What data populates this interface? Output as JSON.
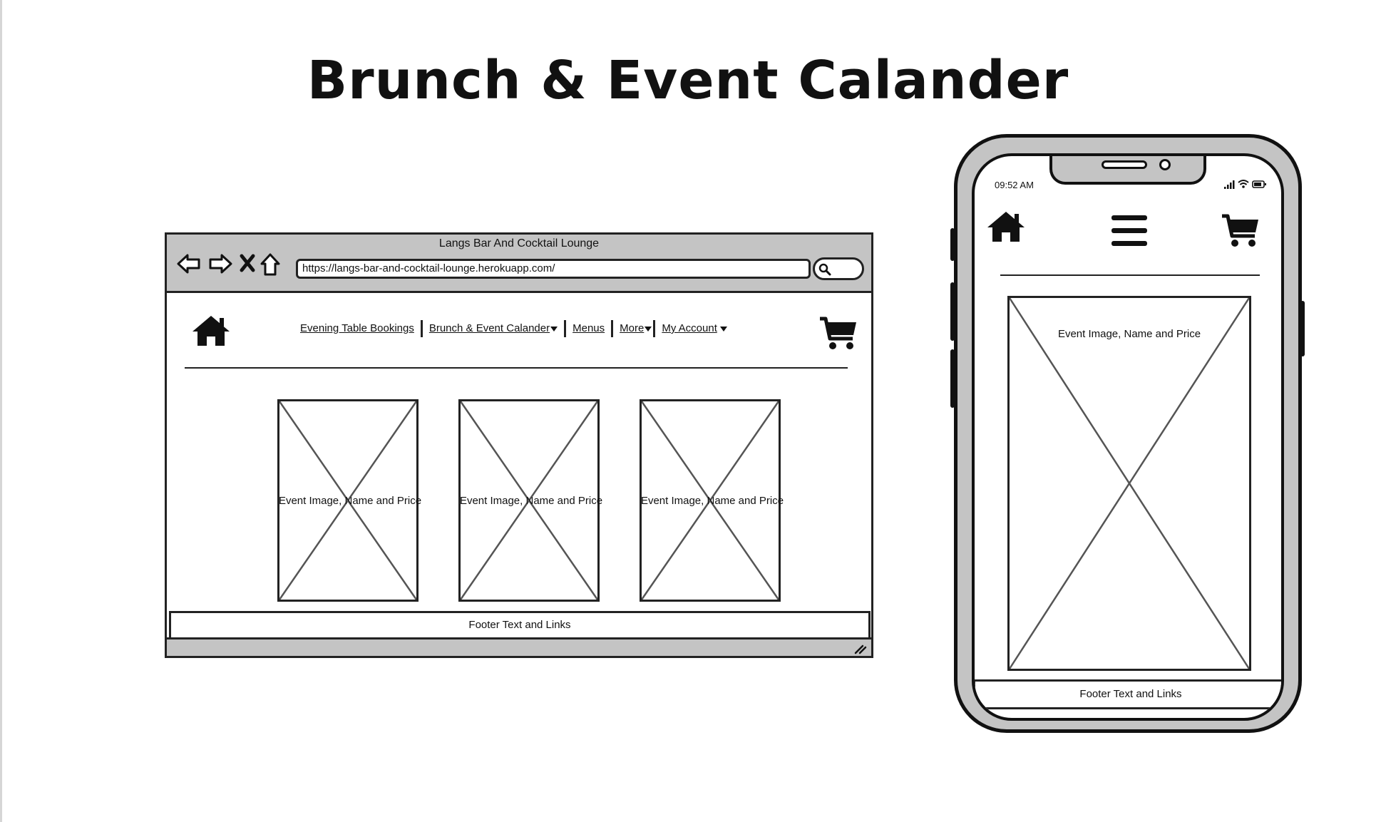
{
  "page_title": "Brunch & Event Calander",
  "desktop": {
    "window_title": "Langs Bar And Cocktail Lounge",
    "url": "https://langs-bar-and-cocktail-lounge.herokuapp.com/",
    "nav": {
      "evening_table_bookings": "Evening Table Bookings",
      "brunch_event_calander": "Brunch & Event Calander",
      "menus": "Menus",
      "more": "More",
      "my_account": "My Account"
    },
    "cards": [
      {
        "label": "Event Image, Name and Price"
      },
      {
        "label": "Event Image, Name and Price"
      },
      {
        "label": "Event Image, Name and Price"
      }
    ],
    "footer": "Footer Text and Links"
  },
  "mobile": {
    "status_time": "09:52 AM",
    "card_label": "Event Image, Name and Price",
    "footer": "Footer Text and Links"
  },
  "icons": [
    "home-icon",
    "cart-icon",
    "hamburger-menu-icon",
    "back-arrow-icon",
    "forward-arrow-icon",
    "stop-icon",
    "browser-home-icon",
    "search-icon",
    "signal-icon",
    "wifi-icon",
    "battery-icon"
  ]
}
